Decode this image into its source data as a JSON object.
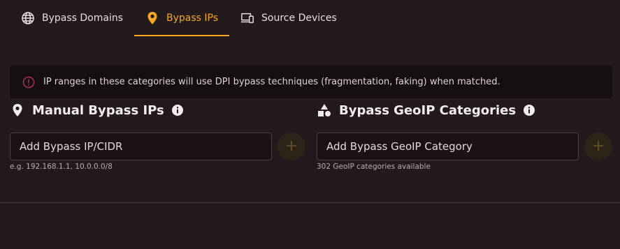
{
  "tabs": [
    {
      "label": "Bypass Domains",
      "icon": "globe-icon",
      "active": false
    },
    {
      "label": "Bypass IPs",
      "icon": "location-pin-icon",
      "active": true
    },
    {
      "label": "Source Devices",
      "icon": "devices-icon",
      "active": false
    }
  ],
  "alert": {
    "icon": "info-circle-icon",
    "text": "IP ranges in these categories will use DPI bypass techniques (fragmentation, faking) when matched."
  },
  "manual_ips": {
    "title": "Manual Bypass IPs",
    "icon": "location-pin-icon",
    "input_placeholder": "Add Bypass IP/CIDR",
    "hint": "e.g. 192.168.1.1, 10.0.0.0/8"
  },
  "geoip": {
    "title": "Bypass GeoIP Categories",
    "icon": "shapes-icon",
    "input_placeholder": "Add Bypass GeoIP Category",
    "hint": "302 GeoIP categories available"
  },
  "colors": {
    "accent": "#f5a623",
    "background": "#231a1d",
    "alert_background": "#160f12",
    "alert_icon": "#a8324a"
  }
}
